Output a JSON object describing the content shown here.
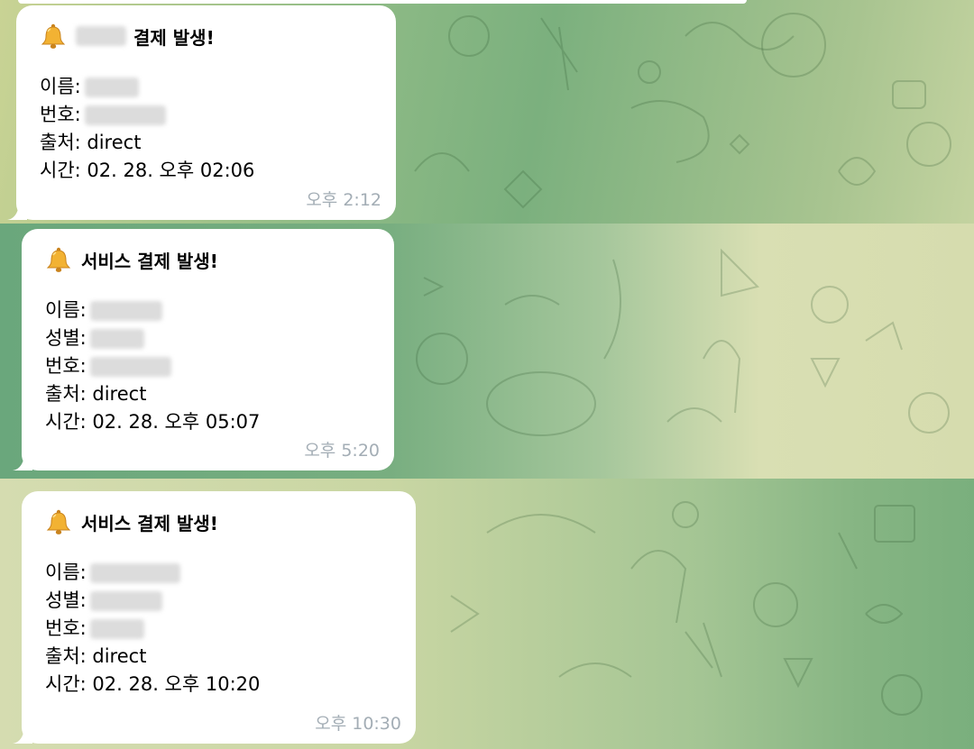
{
  "colors": {
    "bubble": "#ffffff",
    "time_text": "#a3adb5",
    "icon_bell": "#f2b233"
  },
  "messages": [
    {
      "icon": "bell-icon",
      "title": "결제 발생!",
      "title_prefix_redacted": true,
      "lines": [
        {
          "label": "이름:",
          "value": "",
          "redacted": true
        },
        {
          "label": "번호:",
          "value": "",
          "redacted": true
        },
        {
          "label": "출처:",
          "value": " direct",
          "redacted": false
        },
        {
          "label": "시간:",
          "value": " 02. 28. 오후 02:06",
          "redacted": false
        }
      ],
      "time": "오후 2:12"
    },
    {
      "icon": "bell-icon",
      "title": "서비스 결제 발생!",
      "title_prefix_redacted": false,
      "lines": [
        {
          "label": "이름:",
          "value": "",
          "redacted": true
        },
        {
          "label": "성별:",
          "value": "",
          "redacted": true
        },
        {
          "label": "번호:",
          "value": "",
          "redacted": true
        },
        {
          "label": "출처:",
          "value": " direct",
          "redacted": false
        },
        {
          "label": "시간:",
          "value": " 02. 28. 오후 05:07",
          "redacted": false
        }
      ],
      "time": "오후 5:20"
    },
    {
      "icon": "bell-icon",
      "title": "서비스 결제 발생!",
      "title_prefix_redacted": false,
      "lines": [
        {
          "label": "이름:",
          "value": "",
          "redacted": true
        },
        {
          "label": "성별:",
          "value": "",
          "redacted": true
        },
        {
          "label": "번호:",
          "value": "",
          "redacted": true
        },
        {
          "label": "출처:",
          "value": " direct",
          "redacted": false
        },
        {
          "label": "시간:",
          "value": " 02. 28. 오후 10:20",
          "redacted": false
        }
      ],
      "time": "오후 10:30"
    }
  ]
}
